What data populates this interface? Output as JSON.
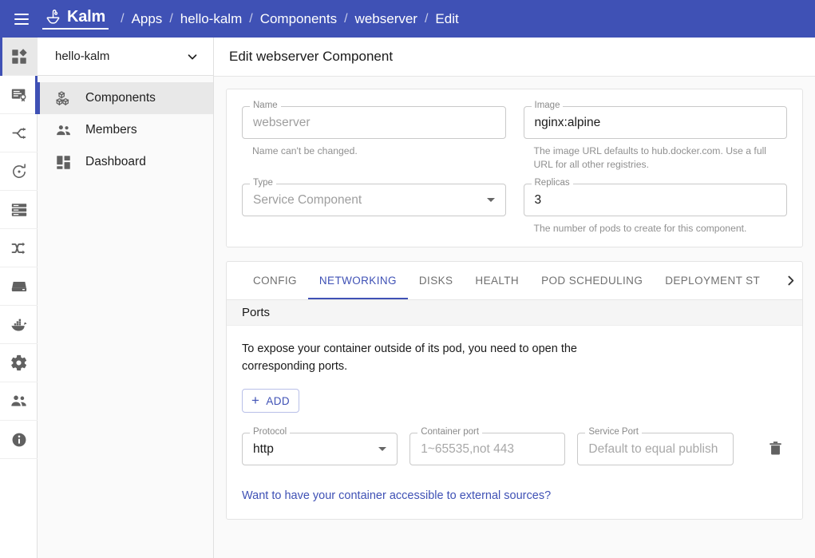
{
  "appbar": {
    "menu_icon": "hamburger-menu-icon",
    "brand": "Kalm",
    "brand_logo": "kalm-sailboat-logo",
    "separator": "/",
    "breadcrumbs": [
      {
        "label": "Apps",
        "href": true
      },
      {
        "label": "hello-kalm",
        "href": true
      },
      {
        "label": "Components",
        "href": true
      },
      {
        "label": "webserver",
        "href": true
      },
      {
        "label": "Edit",
        "href": false
      }
    ],
    "accent_color": "#3f51b5"
  },
  "rail": {
    "items": [
      {
        "name": "applications-icon",
        "active": true,
        "mark_right": false
      },
      {
        "name": "registry-certificate-icon",
        "active": false,
        "mark_right": true
      },
      {
        "name": "routes-icon",
        "active": false,
        "mark_right": false
      },
      {
        "name": "cron-jobs-icon",
        "active": false,
        "mark_right": false
      },
      {
        "name": "nodes-icon",
        "active": false,
        "mark_right": false
      },
      {
        "name": "traffic-shuffle-icon",
        "active": false,
        "mark_right": false
      },
      {
        "name": "disks-storage-icon",
        "active": false,
        "mark_right": false
      },
      {
        "name": "docker-registry-icon",
        "active": false,
        "mark_right": false
      },
      {
        "name": "settings-gear-icon",
        "active": false,
        "mark_right": false
      },
      {
        "name": "members-people-icon",
        "active": false,
        "mark_right": false
      },
      {
        "name": "info-icon",
        "active": false,
        "mark_right": false
      }
    ]
  },
  "sidebar": {
    "project_selector": {
      "value": "hello-kalm",
      "icon": "chevron-down-icon"
    },
    "items": [
      {
        "label": "Components",
        "icon": "components-cubes-icon",
        "active": true
      },
      {
        "label": "Members",
        "icon": "members-people-icon",
        "active": false
      },
      {
        "label": "Dashboard",
        "icon": "dashboard-grid-icon",
        "active": false
      }
    ]
  },
  "page": {
    "title": "Edit webserver Component"
  },
  "basic_form": {
    "name": {
      "label": "Name",
      "value": "webserver",
      "disabled": true,
      "help": "Name can't be changed."
    },
    "image": {
      "label": "Image",
      "value": "nginx:alpine",
      "disabled": false,
      "help": "The image URL defaults to hub.docker.com. Use a full URL for all other registries."
    },
    "type": {
      "label": "Type",
      "value": "Service Component",
      "disabled": true,
      "icon": "dropdown-caret-icon"
    },
    "replicas": {
      "label": "Replicas",
      "value": "3",
      "disabled": false,
      "help": "The number of pods to create for this component."
    }
  },
  "tabs": {
    "items": [
      {
        "label": "CONFIG",
        "active": false
      },
      {
        "label": "NETWORKING",
        "active": true
      },
      {
        "label": "DISKS",
        "active": false
      },
      {
        "label": "HEALTH",
        "active": false
      },
      {
        "label": "POD SCHEDULING",
        "active": false
      },
      {
        "label": "DEPLOYMENT ST",
        "active": false
      }
    ],
    "next_icon": "chevron-right-icon"
  },
  "ports_section": {
    "title": "Ports",
    "description": "To expose your container outside of its pod, you need to open the corresponding ports.",
    "add_button": {
      "label": "ADD",
      "icon": "plus-icon"
    },
    "rows": [
      {
        "protocol": {
          "label": "Protocol",
          "value": "http",
          "placeholder": "",
          "icon": "dropdown-caret-icon"
        },
        "container_port": {
          "label": "Container port",
          "value": "",
          "placeholder": "1~65535,not 443"
        },
        "service_port": {
          "label": "Service Port",
          "value": "",
          "placeholder": "Default to equal publish"
        },
        "delete_icon": "trash-delete-icon"
      }
    ],
    "external_link": "Want to have your container accessible to external sources?"
  }
}
